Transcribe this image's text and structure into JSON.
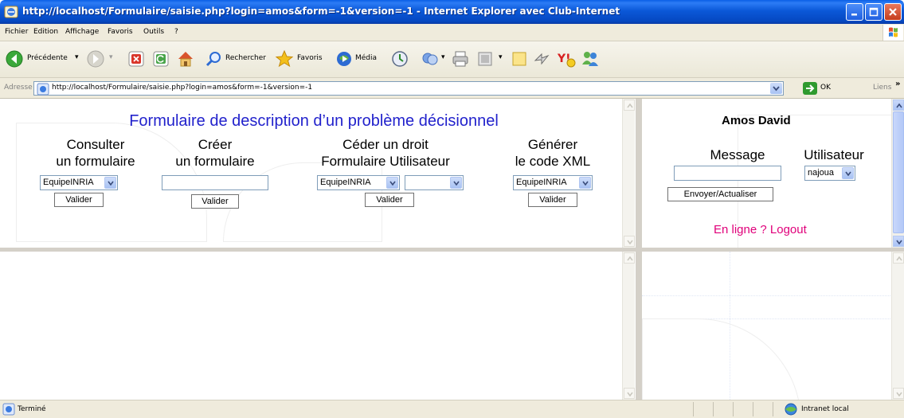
{
  "window": {
    "title": "http://localhost/Formulaire/saisie.php?login=amos&form=-1&version=-1 - Internet Explorer avec Club-Internet"
  },
  "menu": {
    "items": [
      "Fichier",
      "Edition",
      "Affichage",
      "Favoris",
      "Outils",
      "?"
    ]
  },
  "toolbar": {
    "back_label": "Précédente",
    "search_label": "Rechercher",
    "favorites_label": "Favoris",
    "media_label": "Média"
  },
  "address": {
    "label": "Adresse",
    "value": "http://localhost/Formulaire/saisie.php?login=amos&form=-1&version=-1",
    "go_label": "OK",
    "links_label": "Liens",
    "links_chevron": "»"
  },
  "main": {
    "title": "Formulaire de description d’un problème décisionnel",
    "columns": [
      {
        "line1": "Consulter",
        "line2": "un formulaire",
        "select_value": "EquipeINRIA",
        "button_label": "Valider"
      },
      {
        "line1": "Créer",
        "line2": "un formulaire",
        "input_value": "",
        "button_label": "Valider"
      },
      {
        "line1": "Céder un droit",
        "line2": "Formulaire Utilisateur",
        "select_value": "EquipeINRIA",
        "select2_value": "",
        "button_label": "Valider"
      },
      {
        "line1": "Générer",
        "line2": "le code XML",
        "select_value": "EquipeINRIA",
        "button_label": "Valider"
      }
    ]
  },
  "side": {
    "user_name": "Amos David",
    "message_label": "Message",
    "user_label": "Utilisateur",
    "message_value": "",
    "user_select_value": "najoua",
    "send_button_label": "Envoyer/Actualiser",
    "online_link": "En ligne ?",
    "logout_link": "Logout"
  },
  "status": {
    "text": "Terminé",
    "zone": "Intranet local"
  },
  "colors": {
    "title_blue": "#2222cc",
    "link_pink": "#e0007a",
    "xp_titlebar": "#0b58d8"
  }
}
